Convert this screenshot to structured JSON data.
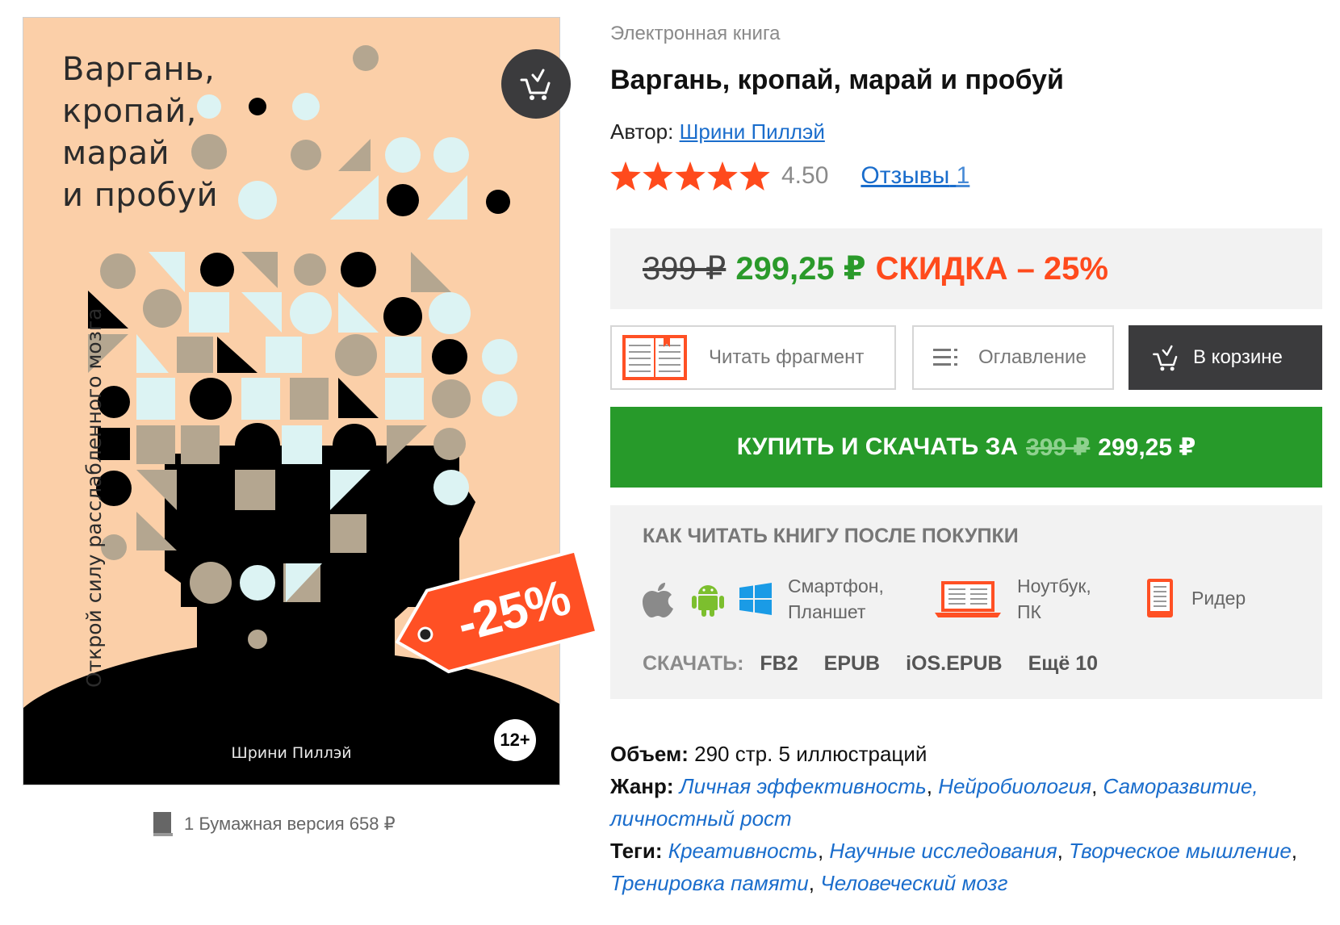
{
  "cover": {
    "title": "Варгань,\nкропай,\nмарай\nи пробуй",
    "subtitle": "Открой силу расслабленного мозга",
    "author": "Шрини Пиллэй",
    "age_rating": "12+",
    "discount_badge": "-25%",
    "cart_icon": "cart-check-icon",
    "background_color": "#fbcfa8"
  },
  "paper_version": {
    "text": "1 Бумажная версия 658 ₽",
    "icon": "book-icon"
  },
  "product": {
    "type": "Электронная книга",
    "title": "Варгань, кропай, марай и пробуй",
    "author_label": "Автор:",
    "author_name": "Шрини Пиллэй",
    "rating_value": "4.50",
    "stars_filled": 5,
    "reviews_label": "Отзывы",
    "reviews_count": "1"
  },
  "price": {
    "old": "399 ₽",
    "new": "299,25 ₽",
    "discount": "СКИДКА – 25%"
  },
  "buttons": {
    "read_fragment": "Читать фрагмент",
    "toc": "Оглавление",
    "in_cart": "В корзине"
  },
  "buy": {
    "label": "КУПИТЬ И СКАЧАТЬ ЗА",
    "old_price": "399 ₽",
    "new_price": "299,25 ₽"
  },
  "how_to_read": {
    "title": "КАК ЧИТАТЬ КНИГУ ПОСЛЕ ПОКУПКИ",
    "devices": [
      {
        "label": "Смартфон,\nПланшет",
        "icons": [
          "apple-icon",
          "android-icon",
          "windows-icon"
        ]
      },
      {
        "label": "Ноутбук,\nПК",
        "icons": [
          "laptop-icon"
        ]
      },
      {
        "label": "Ридер",
        "icons": [
          "ereader-icon"
        ]
      }
    ],
    "download_label": "СКАЧАТЬ:",
    "formats": [
      "FB2",
      "EPUB",
      "iOS.EPUB",
      "Ещё 10"
    ]
  },
  "meta": {
    "volume_label": "Объем:",
    "volume_value": "290 стр. 5 иллюстраций",
    "genre_label": "Жанр:",
    "genres": [
      "Личная эффективность",
      "Нейробиология",
      "Саморазвитие, личностный рост"
    ],
    "tags_label": "Теги:",
    "tags": [
      "Креативность",
      "Научные исследования",
      "Творческое мышление",
      "Тренировка памяти",
      "Человеческий мозг"
    ]
  },
  "colors": {
    "accent_green": "#279a2a",
    "price_green": "#2a9a2a",
    "discount_red": "#ff4a1c",
    "link_blue": "#1a6dcc",
    "dark_button": "#3b3b3d",
    "panel_gray": "#f2f2f2"
  }
}
